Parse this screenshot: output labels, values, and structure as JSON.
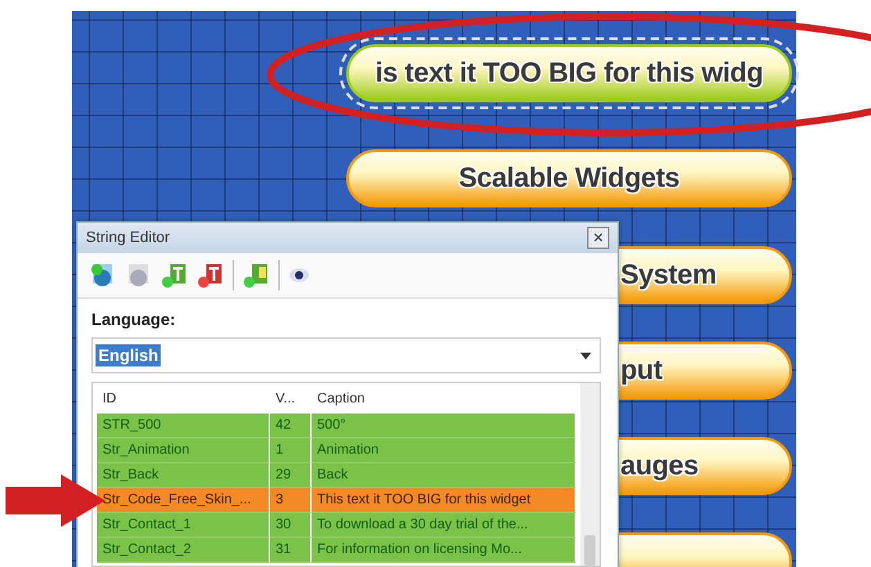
{
  "canvas": {
    "widgets": [
      {
        "text": "is text it TOO BIG for this widg",
        "kind": "overflow",
        "selected": true,
        "color": "#9ccc1c"
      },
      {
        "text": "Scalable Widgets",
        "kind": "full",
        "selected": false,
        "color": "#f59a0c"
      },
      {
        "text": "System",
        "kind": "covered",
        "selected": false,
        "color": "#f59a0c"
      },
      {
        "text": "put",
        "kind": "covered",
        "selected": false,
        "color": "#f59a0c"
      },
      {
        "text": "auges",
        "kind": "covered",
        "selected": false,
        "color": "#f59a0c"
      },
      {
        "kind": "cut",
        "selected": false,
        "color": "#f59a0c"
      }
    ]
  },
  "string_editor": {
    "title": "String Editor",
    "close": "×",
    "language_label": "Language:",
    "language": "English",
    "table": {
      "columns": [
        "ID",
        "V...",
        "Caption"
      ],
      "rows": [
        {
          "cells": [
            "STR_500",
            "42",
            "500°"
          ],
          "selected": false
        },
        {
          "cells": [
            "Str_Animation",
            "1",
            "Animation"
          ],
          "selected": false
        },
        {
          "cells": [
            "Str_Back",
            "29",
            "Back"
          ],
          "selected": false
        },
        {
          "cells": [
            "Str_Code_Free_Skin_...",
            "3",
            "This text it TOO BIG for this widget"
          ],
          "selected": true
        },
        {
          "cells": [
            "Str_Contact_1",
            "30",
            "To download a 30 day trial of the..."
          ],
          "selected": false
        },
        {
          "cells": [
            "Str_Contact_2",
            "31",
            "For information on licensing Mo..."
          ],
          "selected": false
        }
      ]
    }
  }
}
